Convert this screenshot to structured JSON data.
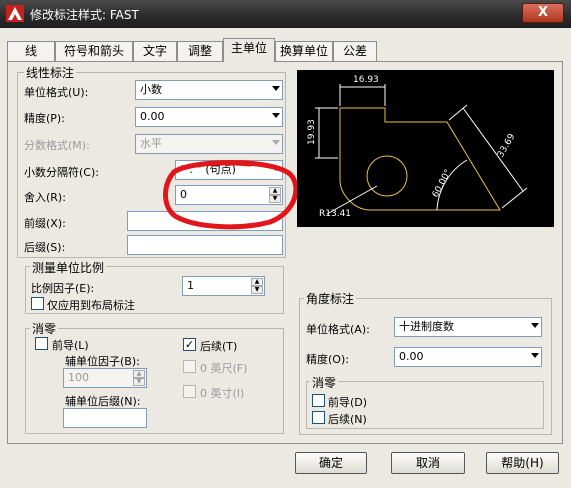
{
  "window": {
    "title": "修改标注样式: FAST",
    "close_label": "X"
  },
  "tabs": [
    {
      "label": "线"
    },
    {
      "label": "符号和箭头"
    },
    {
      "label": "文字"
    },
    {
      "label": "调整"
    },
    {
      "label": "主单位",
      "active": true
    },
    {
      "label": "换算单位"
    },
    {
      "label": "公差"
    }
  ],
  "linear": {
    "group_title": "线性标注",
    "unit_format": {
      "label": "单位格式(U):",
      "value": "小数"
    },
    "precision": {
      "label": "精度(P):",
      "value": "0.00"
    },
    "fraction_format": {
      "label": "分数格式(M):",
      "value": "水平"
    },
    "decimal_separator": {
      "label": "小数分隔符(C):",
      "value": "“ . ” (句点)"
    },
    "round_off": {
      "label": "舍入(R):",
      "value": "0"
    },
    "prefix": {
      "label": "前缀(X):",
      "value": ""
    },
    "suffix": {
      "label": "后缀(S):",
      "value": ""
    }
  },
  "measurement_scale": {
    "group_title": "测量单位比例",
    "scale_factor": {
      "label": "比例因子(E):",
      "value": "1"
    },
    "layout_only": {
      "label": "仅应用到布局标注",
      "checked": false
    }
  },
  "zero_suppression": {
    "group_title": "消零",
    "leading": {
      "label": "前导(L)",
      "checked": false
    },
    "sub_unit_factor": {
      "label": "辅单位因子(B):",
      "value": "100"
    },
    "sub_unit_suffix": {
      "label": "辅单位后缀(N):",
      "value": ""
    },
    "trailing": {
      "label": "后续(T)",
      "checked": true
    },
    "zero_feet": {
      "label": "0 英尺(F)",
      "checked": false
    },
    "zero_inches": {
      "label": "0 英寸(I)",
      "checked": false
    }
  },
  "angular": {
    "group_title": "角度标注",
    "unit_format": {
      "label": "单位格式(A):",
      "value": "十进制度数"
    },
    "precision": {
      "label": "精度(O):",
      "value": "0.00"
    },
    "zero_group_title": "消零",
    "leading": {
      "label": "前导(D)",
      "checked": false
    },
    "trailing": {
      "label": "后续(N)",
      "checked": false
    }
  },
  "preview": {
    "dim_top": "16.93",
    "dim_left": "19.93",
    "dim_right": "33.69",
    "dim_radius": "R13.41",
    "dim_angle": "60.00°"
  },
  "buttons": {
    "ok": "确定",
    "cancel": "取消",
    "help": "帮助(H)"
  },
  "colors": {
    "annotation_red": "#e0161b",
    "preview_bg": "#000000",
    "preview_lines": "#ffffff",
    "preview_shape": "#e8c14a"
  }
}
